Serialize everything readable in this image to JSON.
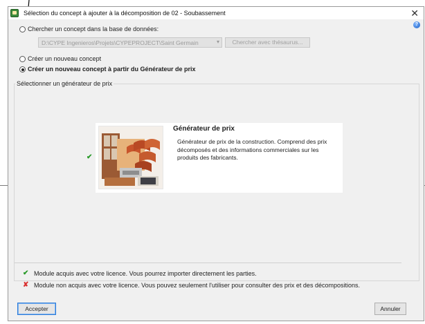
{
  "dialog": {
    "title": "Sélection du concept à ajouter à la décomposition de 02 - Soubassement",
    "close_glyph": "✕",
    "help_glyph": "?"
  },
  "options": {
    "search_label": "Chercher un concept dans la base de données:",
    "path_value": "D:\\CYPE Ingenieros\\Projets\\CYPEPROJECT\\Saint Germain",
    "thesaurus_button": "Chercher avec thésaurus...",
    "new_concept_label": "Créer un nouveau concept",
    "new_from_generator_label": "Créer un nouveau concept à partir du Générateur de prix",
    "selected": "new_from_generator"
  },
  "generator_group": {
    "label": "Sélectionner un générateur de prix",
    "card": {
      "title": "Générateur de prix",
      "description": "Générateur de prix de la construction. Comprend des prix décomposés et des informations commerciales sur les produits des fabricants.",
      "licensed": true
    }
  },
  "legend": {
    "licensed_text": "Module acquis avec votre licence. Vous pourrez importer directement les parties.",
    "unlicensed_text": "Module non acquis avec votre licence. Vous pouvez seulement l'utiliser pour consulter des prix et des décompositions.",
    "check_glyph": "✔",
    "cross_glyph": "✘"
  },
  "buttons": {
    "accept": "Accepter",
    "cancel": "Annuler"
  },
  "colors": {
    "dialog_bg": "#f0f0f0",
    "check_green": "#2a9a2a",
    "cross_red": "#d93030",
    "default_button_border": "#2d7bd8"
  }
}
